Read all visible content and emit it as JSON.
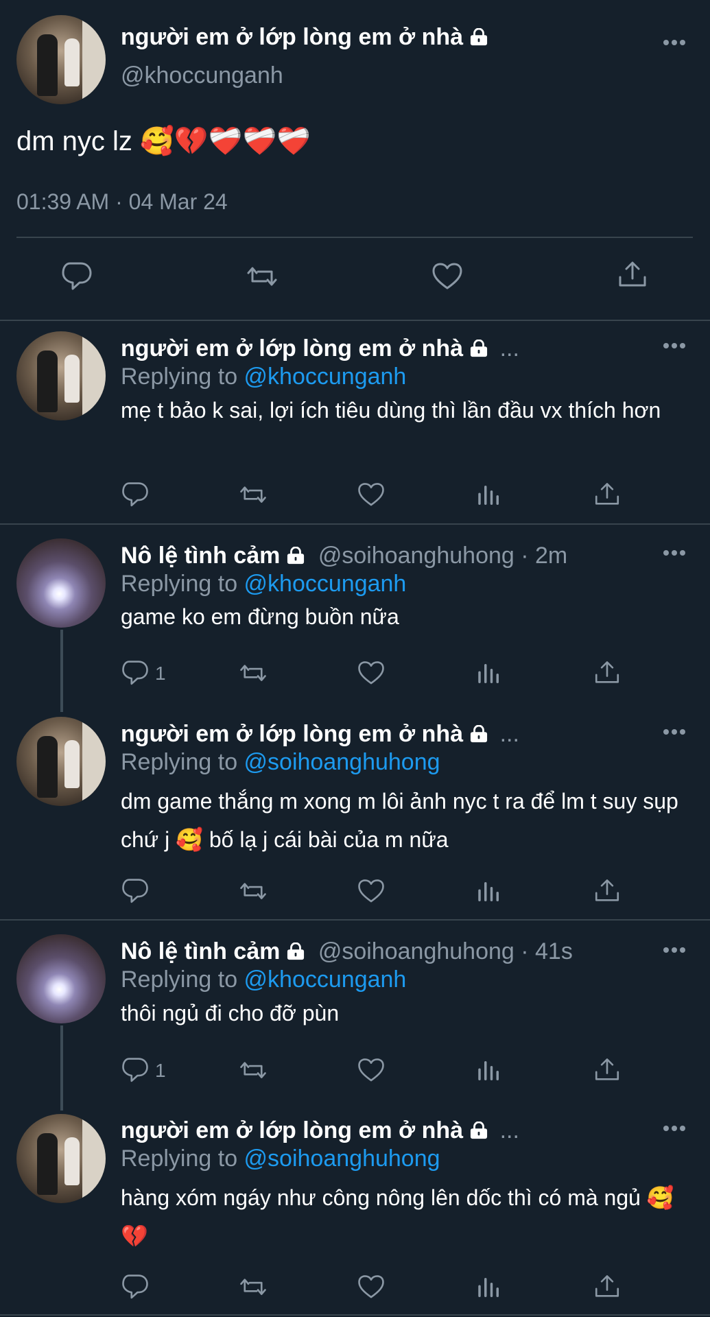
{
  "main_tweet": {
    "name": "người em ở lớp lòng em ở nhà",
    "handle": "@khoccunganh",
    "text": "dm nyc lz 🥰💔❤️‍🩹❤️‍🩹❤️‍🩹",
    "timestamp": "01:39 AM · 04 Mar 24"
  },
  "replies": [
    {
      "name": "người em ở lớp lòng em ở nhà",
      "name_suffix": "...",
      "replying_prefix": "Replying to ",
      "replying_to": "@khoccunganh",
      "text": "mẹ t bảo k sai, lợi ích tiêu dùng thì lần đầu vx thích hơn"
    },
    {
      "name": "Nô lệ tình cảm",
      "handle_time": "@soihoanghuhong · 2m",
      "replying_prefix": "Replying to ",
      "replying_to": "@khoccunganh",
      "text": "game ko em đừng buồn nữa",
      "reply_count": "1"
    },
    {
      "name": "người em ở lớp lòng em ở nhà",
      "name_suffix": "...",
      "replying_prefix": "Replying to ",
      "replying_to": "@soihoanghuhong",
      "text": "dm game thắng m xong m lôi ảnh nyc t ra để lm t suy sụp chứ j 🥰 bố lạ j cái bài của m nữa"
    },
    {
      "name": "Nô lệ tình cảm",
      "handle_time": "@soihoanghuhong · 41s",
      "replying_prefix": "Replying to ",
      "replying_to": "@khoccunganh",
      "text": "thôi ngủ đi cho đỡ pùn",
      "reply_count": "1"
    },
    {
      "name": "người em ở lớp lòng em ở nhà",
      "name_suffix": "...",
      "replying_prefix": "Replying to ",
      "replying_to": "@soihoanghuhong",
      "text": "hàng xóm ngáy như công nông lên dốc thì có mà ngủ 🥰 💔"
    }
  ],
  "icons": {
    "reply": "reply-icon",
    "retweet": "retweet-icon",
    "like": "like-icon",
    "analytics": "analytics-icon",
    "share": "share-icon",
    "lock": "lock-icon",
    "more": "more-icon"
  },
  "colors": {
    "background": "#15202b",
    "divider": "#38444d",
    "secondary_text": "#8b98a5",
    "link": "#1d9bf0"
  }
}
